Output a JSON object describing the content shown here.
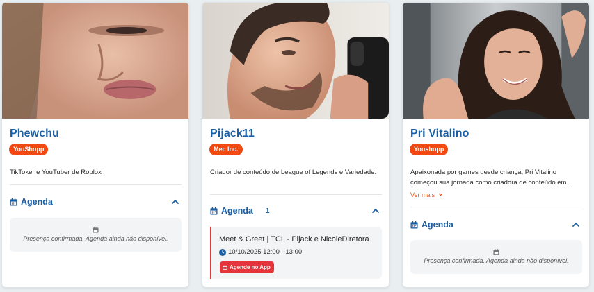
{
  "cards": [
    {
      "name": "Phewchu",
      "badge": "YouShopp",
      "description": "TikToker e YouTuber de Roblox",
      "agenda_title": "Agenda",
      "empty_message": "Presença confirmada. Agenda ainda não disponível."
    },
    {
      "name": "Pijack11",
      "badge": "Mec Inc.",
      "description": "Criador de conteúdo de League of Legends e Variedade.",
      "agenda_title": "Agenda",
      "agenda_count": "1",
      "event": {
        "title": "Meet & Greet | TCL - Pijack e NicoleDiretora",
        "time": "10/10/2025 12:00 - 13:00",
        "button_label": "Agende no App"
      }
    },
    {
      "name": "Pri Vitalino",
      "badge": "Youshopp",
      "description": "Apaixonada por games desde criança, Pri Vitalino começou sua jornada como criadora de conteúdo em...",
      "see_more": "Ver mais",
      "agenda_title": "Agenda",
      "empty_message": "Presença confirmada. Agenda ainda não disponível."
    }
  ],
  "colors": {
    "accent_blue": "#1a5fa3",
    "badge_orange": "#f04a12",
    "event_red": "#e5343a"
  },
  "icons": {
    "calendar": "calendar-icon",
    "chevron": "chevron-up-icon",
    "clock": "clock-icon"
  }
}
